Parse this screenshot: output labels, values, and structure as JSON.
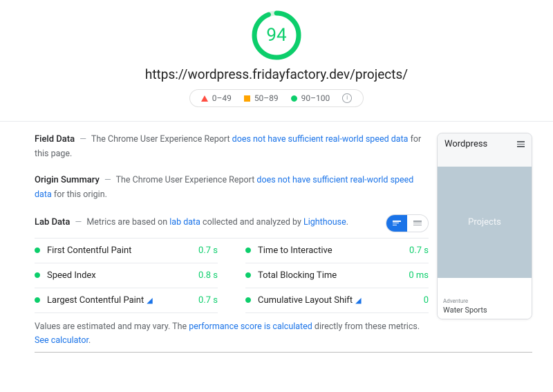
{
  "header": {
    "score": "94",
    "score_pct": 94,
    "url": "https://wordpress.fridayfactory.dev/projects/",
    "legend": {
      "poor": "0–49",
      "avg": "50–89",
      "good": "90–100"
    }
  },
  "field_data": {
    "title": "Field Data",
    "pre": "The Chrome User Experience Report ",
    "link": "does not have sufficient real-world speed data",
    "post": " for this page."
  },
  "origin": {
    "title": "Origin Summary",
    "pre": "The Chrome User Experience Report ",
    "link": "does not have sufficient real-world speed data",
    "post": " for this origin."
  },
  "lab": {
    "title": "Lab Data",
    "desc_pre": "Metrics are based on ",
    "desc_link1": "lab data",
    "desc_mid": " collected and analyzed by ",
    "desc_link2": "Lighthouse",
    "desc_post": "."
  },
  "metrics": [
    {
      "name": "First Contentful Paint",
      "value": "0.7 s",
      "flag": false
    },
    {
      "name": "Time to Interactive",
      "value": "0.7 s",
      "flag": false
    },
    {
      "name": "Speed Index",
      "value": "0.8 s",
      "flag": false
    },
    {
      "name": "Total Blocking Time",
      "value": "0 ms",
      "flag": false
    },
    {
      "name": "Largest Contentful Paint",
      "value": "0.7 s",
      "flag": true
    },
    {
      "name": "Cumulative Layout Shift",
      "value": "0",
      "flag": true
    }
  ],
  "footnote": {
    "pre": "Values are estimated and may vary. The ",
    "link1": "performance score is calculated",
    "mid": " directly from these metrics. ",
    "link2": "See calculator"
  },
  "thumbnail": {
    "title": "Wordpress",
    "mid": "Projects",
    "tag": "Adventure",
    "item": "Water Sports"
  },
  "colors": {
    "good": "#0cce6b",
    "link": "#1a73e8"
  }
}
